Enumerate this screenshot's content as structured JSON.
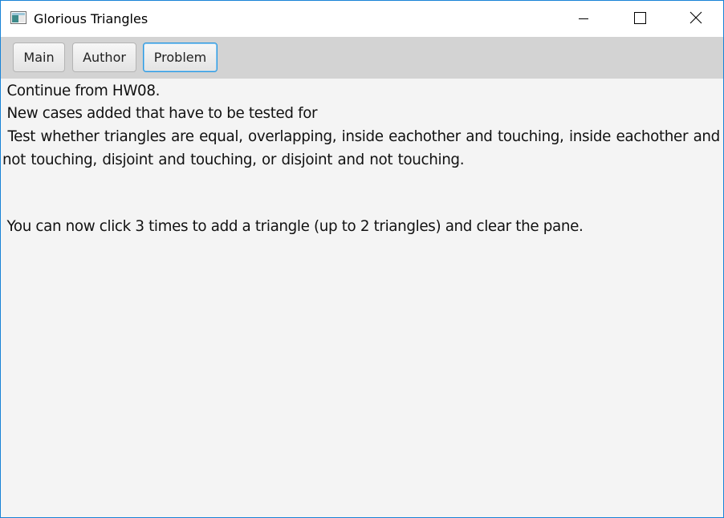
{
  "window": {
    "title": "Glorious Triangles"
  },
  "toolbar": {
    "buttons": [
      {
        "label": "Main"
      },
      {
        "label": "Author"
      },
      {
        "label": "Problem"
      }
    ]
  },
  "content": {
    "paragraphs": [
      " Continue from HW08.",
      " New cases added that have to be tested for",
      " Test whether triangles are equal, overlapping, inside eachother and touching, inside eachother and not touching, disjoint and touching, or disjoint and not touching.",
      " You can now click 3 times to add a triangle (up to 2 triangles) and clear the pane."
    ]
  },
  "icons": {
    "app": "java-window-icon",
    "minimize": "minimize-icon",
    "maximize": "maximize-icon",
    "close": "close-icon"
  },
  "colors": {
    "window_border": "#1883d7",
    "toolbar_background": "#d3d3d3",
    "content_background": "#f4f4f4",
    "focused_button_border": "#2a98e0"
  }
}
